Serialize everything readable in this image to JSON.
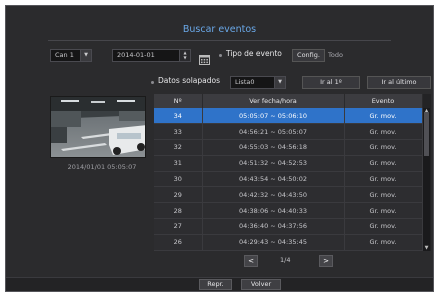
{
  "title": "Buscar eventos",
  "channel": {
    "value": "Can 1"
  },
  "date": {
    "value": "2014-01-01"
  },
  "event_type": {
    "label": "Tipo de evento",
    "config_label": "Config.",
    "value": "Todo"
  },
  "overlap": {
    "label": "Datos solapados",
    "value": "Lista0"
  },
  "nav": {
    "first_label": "Ir al 1º",
    "last_label": "Ir al último"
  },
  "preview": {
    "timestamp": "2014/01/01 05:05:07"
  },
  "table": {
    "headers": {
      "num": "Nº",
      "datetime": "Ver fecha/hora",
      "event": "Evento"
    },
    "rows": [
      {
        "num": "34",
        "time": "05:05:07 ~ 05:06:10",
        "event": "Gr. mov.",
        "selected": true
      },
      {
        "num": "33",
        "time": "04:56:21 ~ 05:05:07",
        "event": "Gr. mov."
      },
      {
        "num": "32",
        "time": "04:55:03 ~ 04:56:18",
        "event": "Gr. mov."
      },
      {
        "num": "31",
        "time": "04:51:32 ~ 04:52:53",
        "event": "Gr. mov."
      },
      {
        "num": "30",
        "time": "04:43:54 ~ 04:50:02",
        "event": "Gr. mov."
      },
      {
        "num": "29",
        "time": "04:42:32 ~ 04:43:50",
        "event": "Gr. mov."
      },
      {
        "num": "28",
        "time": "04:38:06 ~ 04:40:33",
        "event": "Gr. mov."
      },
      {
        "num": "27",
        "time": "04:36:40 ~ 04:37:56",
        "event": "Gr. mov."
      },
      {
        "num": "26",
        "time": "04:29:43 ~ 04:35:45",
        "event": "Gr. mov."
      }
    ]
  },
  "pager": {
    "prev": "<",
    "page": "1/4",
    "next": ">"
  },
  "actions": {
    "play_label": "Repr.",
    "back_label": "Volver"
  },
  "colors": {
    "accent": "#2f73c9",
    "title": "#6aa8e8"
  }
}
